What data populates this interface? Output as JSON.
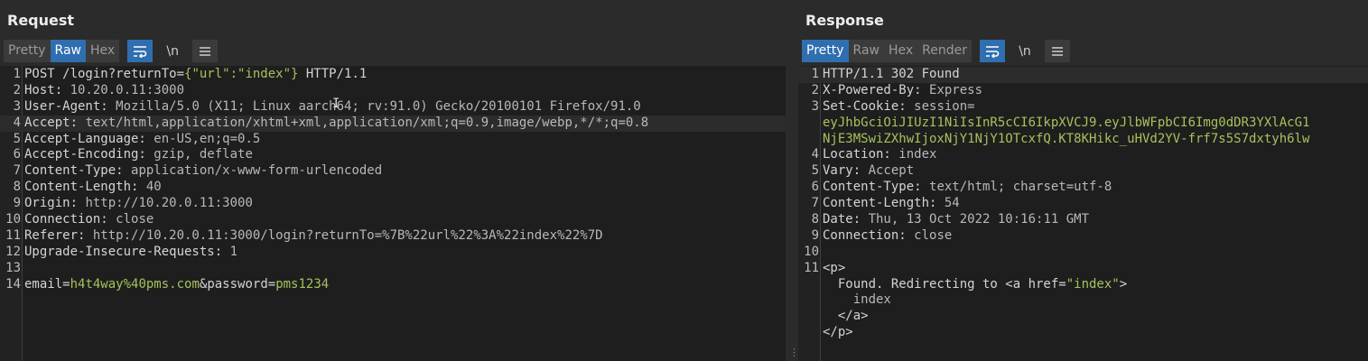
{
  "request": {
    "title": "Request",
    "tabs": [
      "Pretty",
      "Raw",
      "Hex"
    ],
    "active_tab": "Raw",
    "icons": [
      "wrap-icon",
      "newline-icon",
      "menu-icon"
    ],
    "newline_glyph": "\\n",
    "lines": [
      {
        "n": "1",
        "parts": [
          {
            "t": "POST /login?returnTo=",
            "c": "k"
          },
          {
            "t": "{\"url\":\"index\"}",
            "c": "g"
          },
          {
            "t": " HTTP/1.1",
            "c": "k"
          }
        ]
      },
      {
        "n": "2",
        "parts": [
          {
            "t": "Host: ",
            "c": "k"
          },
          {
            "t": "10.20.0.11:3000",
            "c": "val"
          }
        ]
      },
      {
        "n": "3",
        "parts": [
          {
            "t": "User-Agent: ",
            "c": "k"
          },
          {
            "t": "Mozilla/5.0 (X11; Linux aarch64; rv:91.0) Gecko/20100101 Firefox/91.0",
            "c": "val"
          }
        ]
      },
      {
        "n": "4",
        "hl": true,
        "parts": [
          {
            "t": "Accept: ",
            "c": "k"
          },
          {
            "t": "text/html,application/xhtml+xml,application/xml;q=0.9,image/webp,*/*;q=0.8",
            "c": "val"
          }
        ]
      },
      {
        "n": "5",
        "parts": [
          {
            "t": "Accept-Language: ",
            "c": "k"
          },
          {
            "t": "en-US,en;q=0.5",
            "c": "val"
          }
        ]
      },
      {
        "n": "6",
        "parts": [
          {
            "t": "Accept-Encoding: ",
            "c": "k"
          },
          {
            "t": "gzip, deflate",
            "c": "val"
          }
        ]
      },
      {
        "n": "7",
        "parts": [
          {
            "t": "Content-Type: ",
            "c": "k"
          },
          {
            "t": "application/x-www-form-urlencoded",
            "c": "val"
          }
        ]
      },
      {
        "n": "8",
        "parts": [
          {
            "t": "Content-Length: ",
            "c": "k"
          },
          {
            "t": "40",
            "c": "val"
          }
        ]
      },
      {
        "n": "9",
        "parts": [
          {
            "t": "Origin: ",
            "c": "k"
          },
          {
            "t": "http://10.20.0.11:3000",
            "c": "val"
          }
        ]
      },
      {
        "n": "10",
        "parts": [
          {
            "t": "Connection: ",
            "c": "k"
          },
          {
            "t": "close",
            "c": "val"
          }
        ]
      },
      {
        "n": "11",
        "parts": [
          {
            "t": "Referer: ",
            "c": "k"
          },
          {
            "t": "http://10.20.0.11:3000/login?returnTo=%7B%22url%22%3A%22index%22%7D",
            "c": "val"
          }
        ]
      },
      {
        "n": "12",
        "parts": [
          {
            "t": "Upgrade-Insecure-Requests: ",
            "c": "k"
          },
          {
            "t": "1",
            "c": "val"
          }
        ]
      },
      {
        "n": "13",
        "parts": []
      },
      {
        "n": "14",
        "parts": [
          {
            "t": "email",
            "c": "k"
          },
          {
            "t": "=",
            "c": "k"
          },
          {
            "t": "h4t4way%40pms.com",
            "c": "g"
          },
          {
            "t": "&",
            "c": "k"
          },
          {
            "t": "password",
            "c": "k"
          },
          {
            "t": "=",
            "c": "k"
          },
          {
            "t": "pms1234",
            "c": "g"
          }
        ]
      }
    ]
  },
  "response": {
    "title": "Response",
    "tabs": [
      "Pretty",
      "Raw",
      "Hex",
      "Render"
    ],
    "active_tab": "Pretty",
    "icons": [
      "wrap-icon",
      "newline-icon",
      "menu-icon"
    ],
    "newline_glyph": "\\n",
    "lines": [
      {
        "n": "1",
        "hl": true,
        "parts": [
          {
            "t": "HTTP/1.1 302 Found",
            "c": "k"
          }
        ]
      },
      {
        "n": "2",
        "parts": [
          {
            "t": "X-Powered-By: ",
            "c": "k"
          },
          {
            "t": "Express",
            "c": "val"
          }
        ]
      },
      {
        "n": "3",
        "parts": [
          {
            "t": "Set-Cookie: ",
            "c": "k"
          },
          {
            "t": "session=",
            "c": "val"
          }
        ]
      },
      {
        "n": "",
        "parts": [
          {
            "t": "eyJhbGciOiJIUzI1NiIsInR5cCI6IkpXVCJ9.eyJlbWFpbCI6Img0dDR3YXlAcG1",
            "c": "g"
          }
        ]
      },
      {
        "n": "",
        "parts": [
          {
            "t": "NjE3MSwiZXhwIjoxNjY1NjY1OTcxfQ.KT8KHikc_uHVd2YV-frf7s5S7dxtyh6lw",
            "c": "g"
          }
        ]
      },
      {
        "n": "4",
        "parts": [
          {
            "t": "Location: ",
            "c": "k"
          },
          {
            "t": "index",
            "c": "val"
          }
        ]
      },
      {
        "n": "5",
        "parts": [
          {
            "t": "Vary: ",
            "c": "k"
          },
          {
            "t": "Accept",
            "c": "val"
          }
        ]
      },
      {
        "n": "6",
        "parts": [
          {
            "t": "Content-Type: ",
            "c": "k"
          },
          {
            "t": "text/html; charset=utf-8",
            "c": "val"
          }
        ]
      },
      {
        "n": "7",
        "parts": [
          {
            "t": "Content-Length: ",
            "c": "k"
          },
          {
            "t": "54",
            "c": "val"
          }
        ]
      },
      {
        "n": "8",
        "parts": [
          {
            "t": "Date: ",
            "c": "k"
          },
          {
            "t": "Thu, 13 Oct 2022 10:16:11 GMT",
            "c": "val"
          }
        ]
      },
      {
        "n": "9",
        "parts": [
          {
            "t": "Connection: ",
            "c": "k"
          },
          {
            "t": "close",
            "c": "val"
          }
        ]
      },
      {
        "n": "10",
        "parts": []
      },
      {
        "n": "11",
        "parts": [
          {
            "t": "<p>",
            "c": "k"
          }
        ]
      },
      {
        "n": "",
        "parts": [
          {
            "t": "  Found. Redirecting to <a href=",
            "c": "k"
          },
          {
            "t": "\"index\"",
            "c": "g"
          },
          {
            "t": ">",
            "c": "k"
          }
        ]
      },
      {
        "n": "",
        "parts": [
          {
            "t": "    index",
            "c": "val"
          }
        ]
      },
      {
        "n": "",
        "parts": [
          {
            "t": "  </a>",
            "c": "k"
          }
        ]
      },
      {
        "n": "",
        "parts": [
          {
            "t": "</p>",
            "c": "k"
          }
        ]
      }
    ]
  },
  "colors": {
    "active_tab": "#2f6eaf",
    "background": "#1e1e1e",
    "string_green": "#a5c25c"
  }
}
